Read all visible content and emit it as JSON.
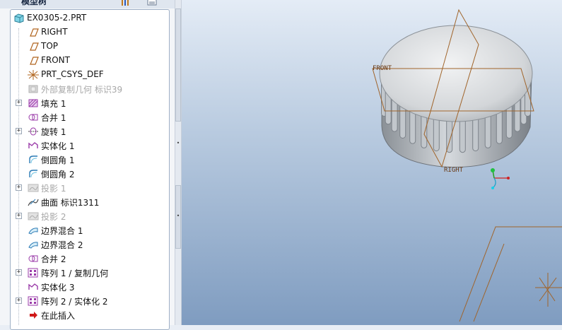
{
  "panel": {
    "title": "模型树",
    "header_icons": [
      "show-menu-icon",
      "settings-list-icon"
    ]
  },
  "tree": {
    "root": {
      "label": "EX0305-2.PRT",
      "icon": "part-icon"
    },
    "items": [
      {
        "label": "RIGHT",
        "icon": "datum-plane-icon",
        "expandable": false,
        "dimmed": false
      },
      {
        "label": "TOP",
        "icon": "datum-plane-icon",
        "expandable": false,
        "dimmed": false
      },
      {
        "label": "FRONT",
        "icon": "datum-plane-icon",
        "expandable": false,
        "dimmed": false
      },
      {
        "label": "PRT_CSYS_DEF",
        "icon": "coordinate-system-icon",
        "expandable": false,
        "dimmed": false
      },
      {
        "label": "外部复制几何 标识39",
        "icon": "external-copy-geometry-icon",
        "expandable": false,
        "dimmed": true
      },
      {
        "label": "填充 1",
        "icon": "fill-icon",
        "expandable": true,
        "dimmed": false
      },
      {
        "label": "合并 1",
        "icon": "merge-icon",
        "expandable": false,
        "dimmed": false
      },
      {
        "label": "旋转 1",
        "icon": "revolve-icon",
        "expandable": true,
        "dimmed": false
      },
      {
        "label": "实体化 1",
        "icon": "solidify-icon",
        "expandable": false,
        "dimmed": false
      },
      {
        "label": "倒圆角 1",
        "icon": "round-icon",
        "expandable": false,
        "dimmed": false
      },
      {
        "label": "倒圆角 2",
        "icon": "round-icon",
        "expandable": false,
        "dimmed": false
      },
      {
        "label": "投影 1",
        "icon": "projection-icon",
        "expandable": true,
        "dimmed": true
      },
      {
        "label": "曲面 标识1311",
        "icon": "surface-icon",
        "expandable": false,
        "dimmed": false
      },
      {
        "label": "投影 2",
        "icon": "projection-icon",
        "expandable": true,
        "dimmed": true
      },
      {
        "label": "边界混合 1",
        "icon": "boundary-blend-icon",
        "expandable": false,
        "dimmed": false
      },
      {
        "label": "边界混合 2",
        "icon": "boundary-blend-icon",
        "expandable": false,
        "dimmed": false
      },
      {
        "label": "合并 2",
        "icon": "merge-icon",
        "expandable": false,
        "dimmed": false
      },
      {
        "label": "阵列 1 / 复制几何",
        "icon": "pattern-icon",
        "expandable": true,
        "dimmed": false
      },
      {
        "label": "实体化 3",
        "icon": "solidify-icon",
        "expandable": false,
        "dimmed": false
      },
      {
        "label": "阵列 2 / 实体化 2",
        "icon": "pattern-icon",
        "expandable": true,
        "dimmed": false
      },
      {
        "label": "在此插入",
        "icon": "insert-here-arrow-icon",
        "expandable": false,
        "dimmed": false
      }
    ]
  },
  "viewport": {
    "labels": {
      "front": "FRONT",
      "right": "RIGHT"
    },
    "colors": {
      "datum": "#a0642a",
      "bg_top": "#e4ecf6",
      "bg_bottom": "#7f9cc0"
    }
  }
}
